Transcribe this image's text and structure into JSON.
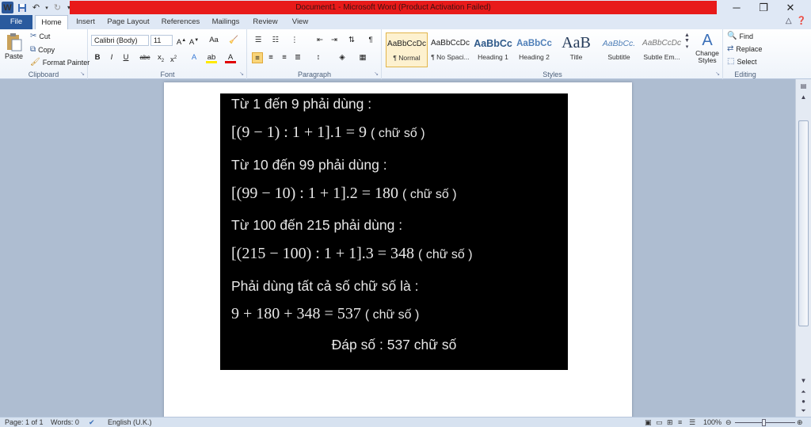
{
  "window": {
    "title": "Document1 - Microsoft Word (Product Activation Failed)",
    "logo": "W",
    "accent_color": "#e81a1a"
  },
  "tabs": [
    "File",
    "Home",
    "Insert",
    "Page Layout",
    "References",
    "Mailings",
    "Review",
    "View"
  ],
  "ribbon": {
    "clipboard": {
      "paste": "Paste",
      "cut": "Cut",
      "copy": "Copy",
      "format_painter": "Format Painter",
      "label": "Clipboard"
    },
    "font": {
      "font_name": "Calibri (Body)",
      "font_size": "11",
      "change_case": "Aa",
      "label": "Font"
    },
    "paragraph": {
      "label": "Paragraph"
    },
    "styles": {
      "items": [
        {
          "preview": "AaBbCcDc",
          "name": "¶ Normal"
        },
        {
          "preview": "AaBbCcDc",
          "name": "¶ No Spaci..."
        },
        {
          "preview": "AaBbCc",
          "name": "Heading 1"
        },
        {
          "preview": "AaBbCc",
          "name": "Heading 2"
        },
        {
          "preview": "AaB",
          "name": "Title"
        },
        {
          "preview": "AaBbCc.",
          "name": "Subtitle"
        },
        {
          "preview": "AaBbCcDc",
          "name": "Subtle Em..."
        }
      ],
      "change_styles": "Change Styles",
      "label": "Styles"
    },
    "editing": {
      "find": "Find",
      "replace": "Replace",
      "select": "Select",
      "label": "Editing"
    }
  },
  "document": {
    "lines": [
      {
        "kind": "text",
        "text": "Từ 1 đến 9 phải dùng :"
      },
      {
        "kind": "math",
        "expr": "[(9 − 1) : 1 + 1].1 = 9",
        "note": "( chữ số )"
      },
      {
        "kind": "text",
        "text": "Từ 10 đến 99 phải dùng :"
      },
      {
        "kind": "math",
        "expr": "[(99 − 10) : 1 + 1].2 = 180",
        "note": "( chữ số )"
      },
      {
        "kind": "text",
        "text": "Từ 100 đến 215 phải dùng :"
      },
      {
        "kind": "math",
        "expr": "[(215 − 100) : 1 + 1].3 = 348",
        "note": "( chữ số )"
      },
      {
        "kind": "text",
        "text": "Phải dùng tất cả số chữ số là :"
      },
      {
        "kind": "math",
        "expr": "9 + 180 + 348 = 537",
        "note": "( chữ số )"
      },
      {
        "kind": "answer",
        "text": "Đáp số : 537 chữ số"
      }
    ]
  },
  "status": {
    "page": "Page: 1 of 1",
    "words": "Words: 0",
    "language": "English (U.K.)",
    "zoom": "100%",
    "zoom_level_percent": 100
  }
}
